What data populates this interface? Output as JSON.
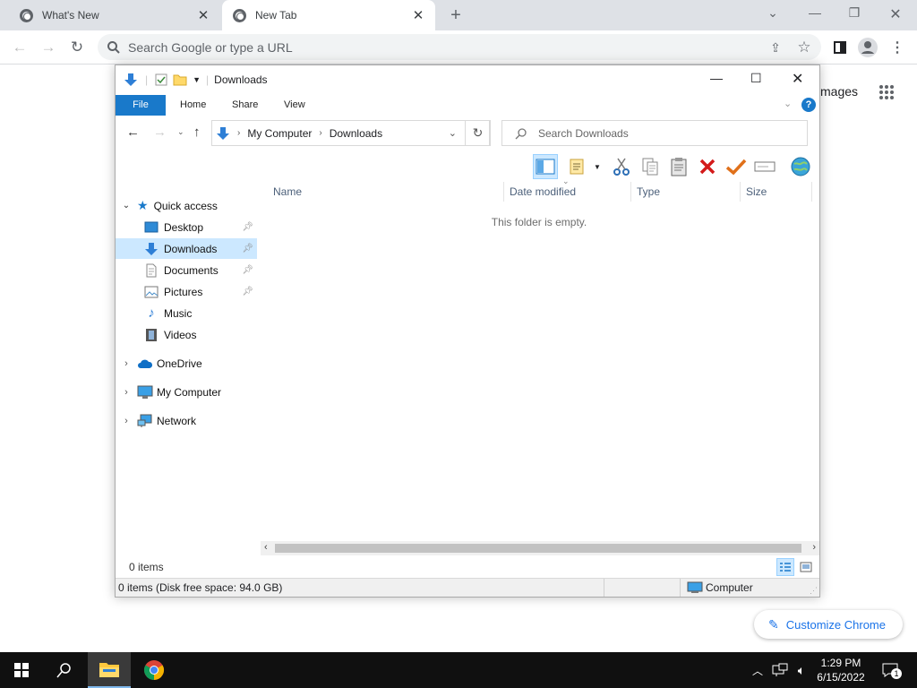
{
  "browser": {
    "tabs": [
      {
        "title": "What's New",
        "active": false
      },
      {
        "title": "New Tab",
        "active": true
      }
    ],
    "omnibox_placeholder": "Search Google or type a URL",
    "bg_images_label": "mages",
    "customize_label": "Customize Chrome"
  },
  "explorer": {
    "title": "Downloads",
    "ribbon_tabs": [
      "File",
      "Home",
      "Share",
      "View"
    ],
    "breadcrumb": [
      "My Computer",
      "Downloads"
    ],
    "search_placeholder": "Search Downloads",
    "columns": [
      "Name",
      "Date modified",
      "Type",
      "Size"
    ],
    "empty_message": "This folder is empty.",
    "nav": {
      "quick_access": "Quick access",
      "quick_items": [
        {
          "label": "Desktop",
          "icon": "desktop-icon",
          "pinned": true
        },
        {
          "label": "Downloads",
          "icon": "download-arrow-icon",
          "pinned": true,
          "selected": true
        },
        {
          "label": "Documents",
          "icon": "document-icon",
          "pinned": true
        },
        {
          "label": "Pictures",
          "icon": "picture-icon",
          "pinned": true
        },
        {
          "label": "Music",
          "icon": "music-note-icon",
          "pinned": false
        },
        {
          "label": "Videos",
          "icon": "film-icon",
          "pinned": false
        }
      ],
      "roots": [
        {
          "label": "OneDrive",
          "icon": "cloud-icon"
        },
        {
          "label": "My Computer",
          "icon": "computer-icon"
        },
        {
          "label": "Network",
          "icon": "network-icon"
        }
      ]
    },
    "item_count": "0 items",
    "status_text": "0 items (Disk free space: 94.0 GB)",
    "status_location": "Computer"
  },
  "taskbar": {
    "time": "1:29 PM",
    "date": "6/15/2022",
    "notification_count": "1"
  },
  "colors": {
    "accent": "#1979ca",
    "selection": "#cce8ff",
    "taskbar": "#101010",
    "chrome_frame": "#dee1e6"
  }
}
